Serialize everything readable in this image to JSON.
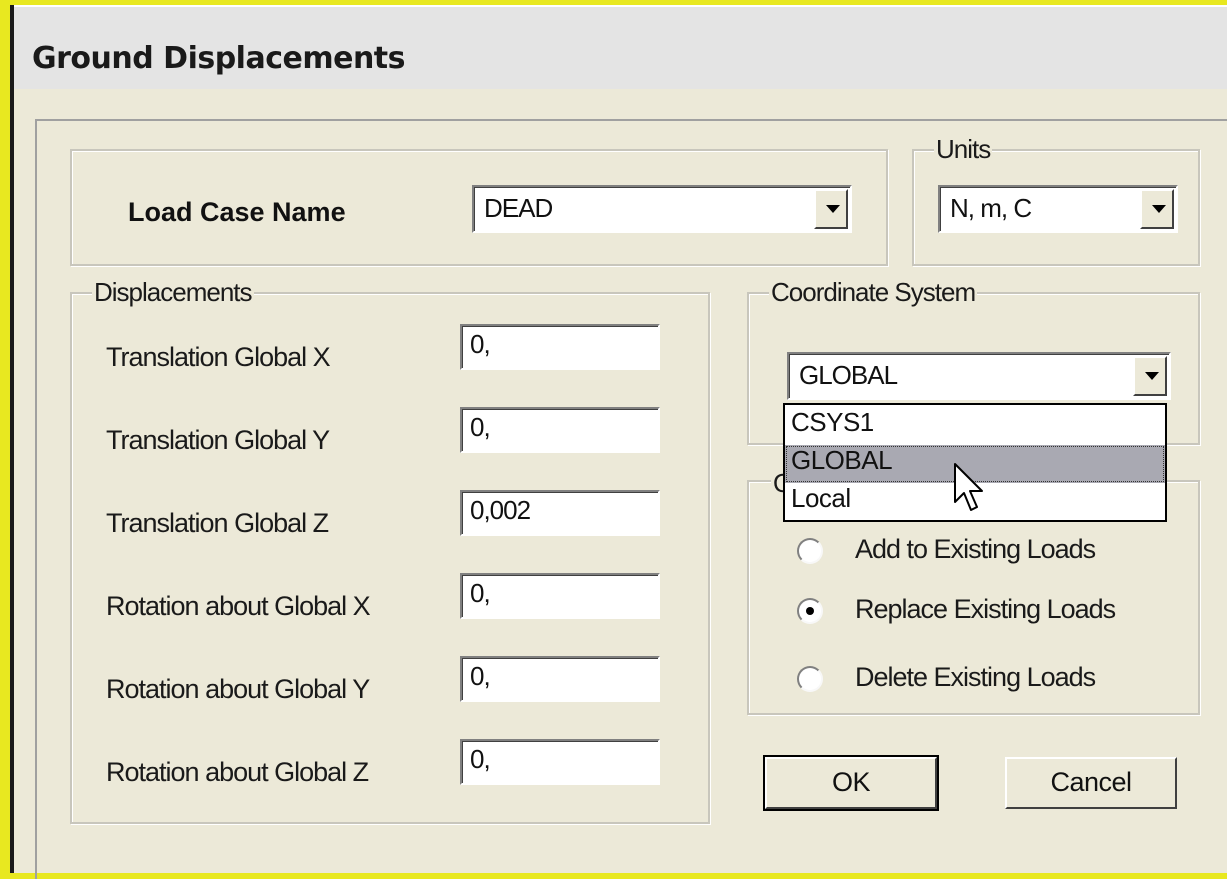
{
  "window": {
    "title": "Ground Displacements"
  },
  "load_case": {
    "label": "Load Case Name",
    "value": "DEAD"
  },
  "units": {
    "legend": "Units",
    "value": "N, m, C"
  },
  "displacements": {
    "legend": "Displacements",
    "rows": [
      {
        "label": "Translation Global X",
        "value": "0,"
      },
      {
        "label": "Translation Global Y",
        "value": "0,"
      },
      {
        "label": "Translation Global Z",
        "value": "0,002"
      },
      {
        "label": "Rotation about Global X",
        "value": "0,"
      },
      {
        "label": "Rotation about Global Y",
        "value": "0,"
      },
      {
        "label": "Rotation about Global Z",
        "value": "0,"
      }
    ]
  },
  "coordinate_system": {
    "legend": "Coordinate System",
    "value": "GLOBAL",
    "options": [
      "CSYS1",
      "GLOBAL",
      "Local"
    ],
    "highlighted": "GLOBAL"
  },
  "options": {
    "legend_visible_fragment": "O",
    "radios": [
      {
        "label": "Add to Existing Loads",
        "checked": false
      },
      {
        "label": "Replace Existing Loads",
        "checked": true
      },
      {
        "label": "Delete Existing Loads",
        "checked": false
      }
    ]
  },
  "buttons": {
    "ok": "OK",
    "cancel": "Cancel"
  }
}
